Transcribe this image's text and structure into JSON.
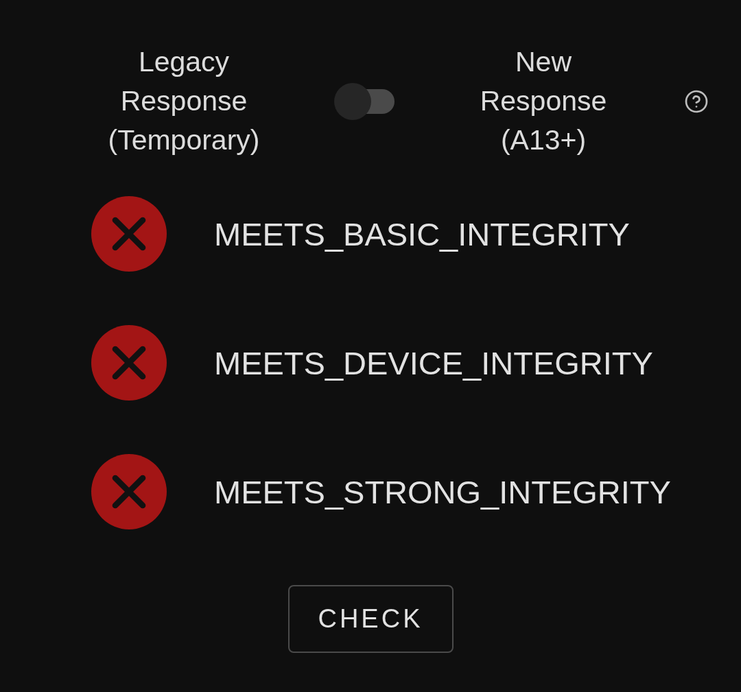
{
  "toggle": {
    "left_label": "Legacy Response (Temporary)",
    "right_label": "New Response (A13+)",
    "on": false
  },
  "checks": [
    {
      "label": "MEETS_BASIC_INTEGRITY",
      "passed": false
    },
    {
      "label": "MEETS_DEVICE_INTEGRITY",
      "passed": false
    },
    {
      "label": "MEETS_STRONG_INTEGRITY",
      "passed": false
    }
  ],
  "button": "CHECK"
}
